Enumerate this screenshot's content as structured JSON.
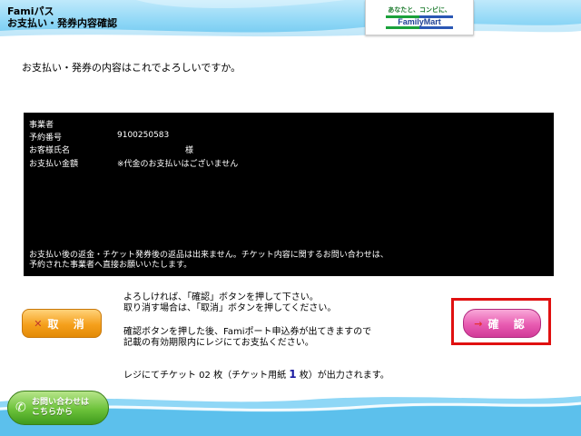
{
  "header": {
    "title_line1": "Famiパス",
    "title_line2": "お支払い・発券内容確認",
    "logo_tagline": "あなたと、コンビに、",
    "logo_brand": "FamilyMart"
  },
  "prompt": "お支払い・発券の内容はこれでよろしいですか。",
  "details": {
    "operator_label": "事業者",
    "operator_value": "",
    "reservation_label": "予約番号",
    "reservation_value": "9100250583",
    "customer_label": "お客様氏名",
    "customer_suffix": "様",
    "payment_label": "お支払い金額",
    "payment_value": "※代金のお支払いはございません",
    "note_line1": "お支払い後の返金・チケット発券後の返品は出来ません。チケット内容に関するお問い合わせは、",
    "note_line2": "予約された事業者へ直接お願いいたします。"
  },
  "buttons": {
    "cancel_symbol": "✕",
    "cancel_label": "取 消",
    "confirm_symbol": "→",
    "confirm_label": "確 認",
    "contact_line1": "お問い合わせは",
    "contact_line2": "こちらから"
  },
  "instructions": {
    "line1": "よろしければ、「確認」ボタンを押して下さい。",
    "line2": "取り消す場合は、「取消」ボタンを押してください。",
    "line3": "確認ボタンを押した後、Famiポート申込券が出てきますので",
    "line4": "記載の有効期限内にレジにてお支払ください。"
  },
  "output": {
    "prefix": "レジにてチケット 02 枚（チケット用紙 ",
    "paper_count": "1",
    "suffix": " 枚）が出力されます。"
  },
  "colors": {
    "header": "#8fd7f6",
    "cancel": "#f5a01c",
    "confirm": "#e85bb1",
    "highlight": "#e01010",
    "contact": "#6cc23a"
  }
}
